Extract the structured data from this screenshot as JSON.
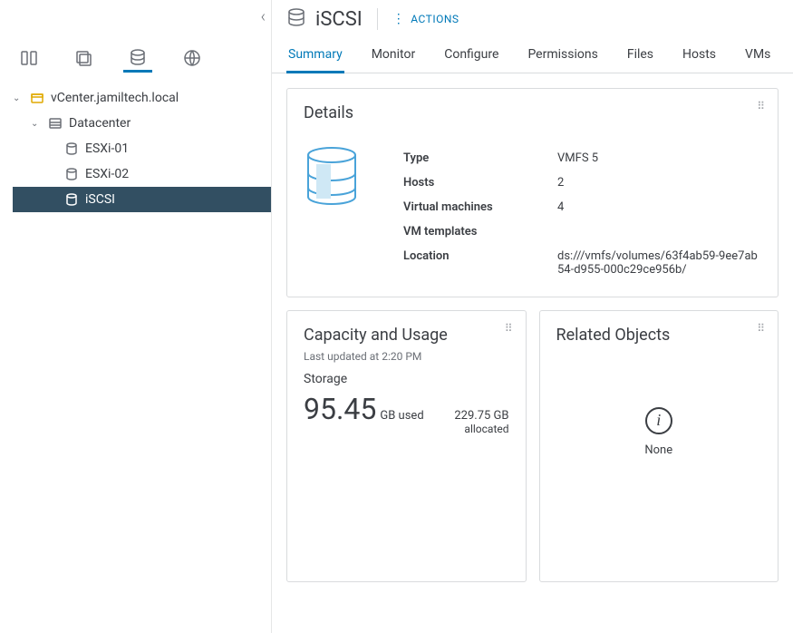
{
  "nav": {
    "collapse_glyph": "‹",
    "tabs": [
      "hosts-clusters",
      "vms-templates",
      "storage",
      "networking"
    ],
    "tree": {
      "vcenter": {
        "label": "vCenter.jamiltech.local"
      },
      "datacenter": {
        "label": "Datacenter"
      },
      "items": [
        {
          "label": "ESXi-01",
          "selected": false
        },
        {
          "label": "ESXi-02",
          "selected": false
        },
        {
          "label": "iSCSI",
          "selected": true
        }
      ]
    }
  },
  "header": {
    "title": "iSCSI",
    "actions_label": "ACTIONS"
  },
  "main_tabs": [
    "Summary",
    "Monitor",
    "Configure",
    "Permissions",
    "Files",
    "Hosts",
    "VMs"
  ],
  "active_tab": "Summary",
  "details": {
    "card_title": "Details",
    "rows": {
      "type": {
        "k": "Type",
        "v": "VMFS 5"
      },
      "hosts": {
        "k": "Hosts",
        "v": "2"
      },
      "vms": {
        "k": "Virtual machines",
        "v": "4"
      },
      "templates": {
        "k": "VM templates",
        "v": ""
      },
      "location": {
        "k": "Location",
        "v": "ds:///vmfs/volumes/63f4ab59-9ee7ab54-d955-000c29ce956b/"
      }
    }
  },
  "capacity": {
    "card_title": "Capacity and Usage",
    "last_updated": "Last updated at 2:20 PM",
    "storage_label": "Storage",
    "used_value": "95.45",
    "used_unit": "GB used",
    "allocated_value": "229.75 GB",
    "allocated_label": "allocated"
  },
  "related": {
    "card_title": "Related Objects",
    "none_label": "None"
  }
}
